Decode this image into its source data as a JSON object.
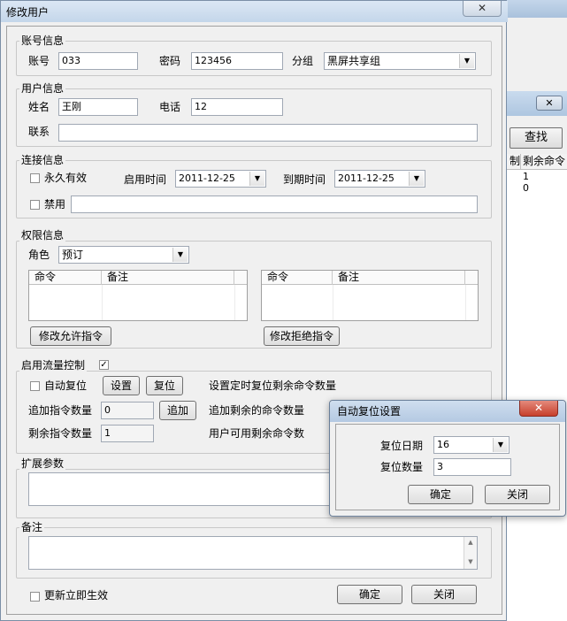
{
  "dialog": {
    "title": "修改用户",
    "close_glyph": "✕"
  },
  "account": {
    "group_label": "账号信息",
    "account_label": "账号",
    "account_value": "033",
    "password_label": "密码",
    "password_value": "123456",
    "group_field_label": "分组",
    "group_value": "黑屏共享组"
  },
  "user": {
    "group_label": "用户信息",
    "name_label": "姓名",
    "name_value": "王刚",
    "phone_label": "电话",
    "phone_value": "12",
    "contact_label": "联系",
    "contact_value": ""
  },
  "connection": {
    "group_label": "连接信息",
    "permanent_label": "永久有效",
    "start_label": "启用时间",
    "start_value": "2011-12-25",
    "expire_label": "到期时间",
    "expire_value": "2011-12-25",
    "disable_label": "禁用",
    "disable_value": ""
  },
  "permissions": {
    "group_label": "权限信息",
    "role_label": "角色",
    "role_value": "预订",
    "allowed_columns": [
      "命令",
      "备注"
    ],
    "denied_columns": [
      "命令",
      "备注"
    ],
    "edit_allowed_label": "修改允许指令",
    "edit_denied_label": "修改拒绝指令"
  },
  "flow": {
    "group_label": "启用流量控制",
    "enabled_mark": "✓",
    "auto_reset_label": "自动复位",
    "set_label": "设置",
    "reset_label": "复位",
    "set_desc": "设置定时复位剩余命令数量",
    "add_count_label": "追加指令数量",
    "add_count_value": "0",
    "add_button_label": "追加",
    "add_desc": "追加剩余的命令数量",
    "remain_label": "剩余指令数量",
    "remain_value": "1",
    "remain_desc": "用户可用剩余命令数"
  },
  "extension": {
    "group_label": "扩展参数"
  },
  "remarks": {
    "group_label": "备注"
  },
  "footer": {
    "immediate_label": "更新立即生效",
    "ok_label": "确定",
    "close_label": "关闭"
  },
  "popup": {
    "title": "自动复位设置",
    "close_glyph": "✕",
    "date_label": "复位日期",
    "date_value": "16",
    "count_label": "复位数量",
    "count_value": "3",
    "ok_label": "确定",
    "close_label": "关闭"
  },
  "background": {
    "find_label": "查找",
    "col_limit_tail": "制",
    "col_remaining": "剩余命令",
    "rows": [
      {
        "remaining": "1"
      },
      {
        "remaining": "0"
      }
    ],
    "close_glyph": "✕"
  }
}
